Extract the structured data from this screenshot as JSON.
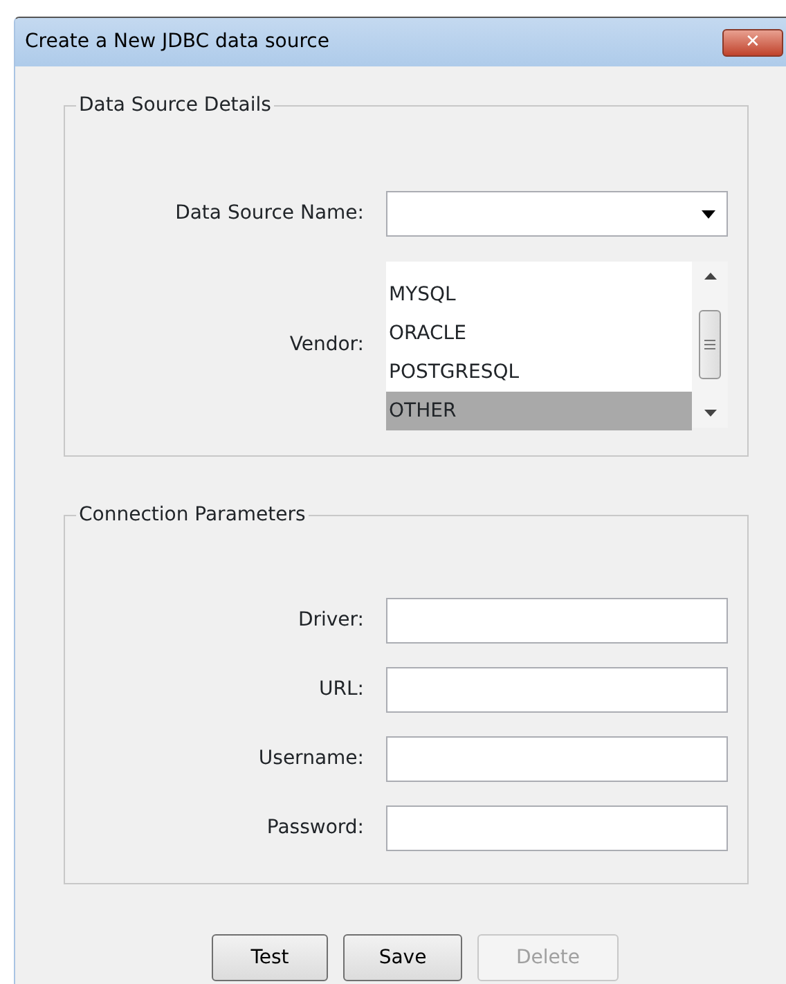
{
  "window": {
    "title": "Create a New JDBC data source",
    "close_label": "✕"
  },
  "data_source_details": {
    "legend": "Data Source Details",
    "name_field": {
      "label": "Data Source Name:"
    },
    "vendor": {
      "label": "Vendor:",
      "items": [
        {
          "text": "MYSQL",
          "selected": false
        },
        {
          "text": "ORACLE",
          "selected": false
        },
        {
          "text": "POSTGRESQL",
          "selected": false
        },
        {
          "text": "OTHER",
          "selected": true
        }
      ]
    }
  },
  "connection_parameters": {
    "legend": "Connection Parameters",
    "fields": [
      {
        "label": "Driver:"
      },
      {
        "label": "URL:"
      },
      {
        "label": "Username:"
      },
      {
        "label": "Password:"
      }
    ]
  },
  "buttons": [
    {
      "label": "Test",
      "disabled": false
    },
    {
      "label": "Save",
      "disabled": false
    },
    {
      "label": "Delete",
      "disabled": true
    }
  ]
}
